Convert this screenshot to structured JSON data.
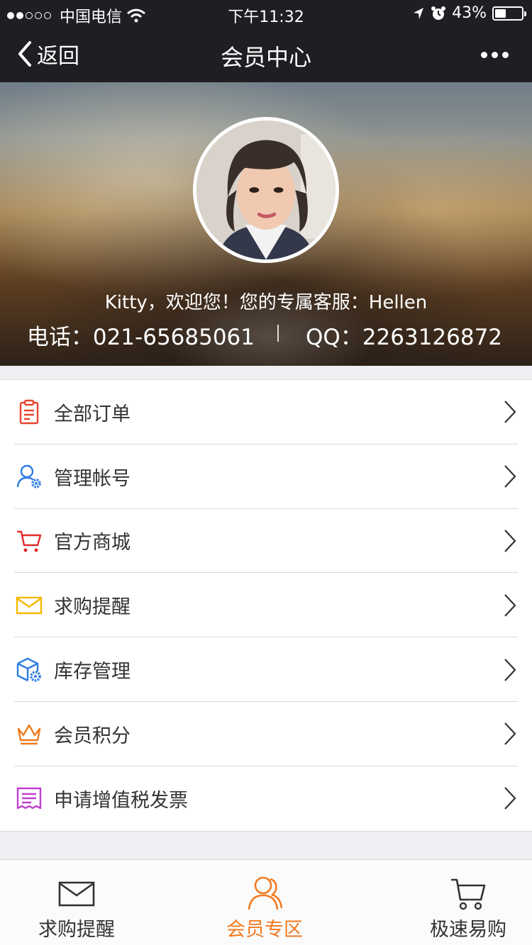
{
  "status_bar": {
    "carrier": "中国电信",
    "time": "下午11:32",
    "battery": "43%",
    "battery_level": 0.43,
    "signal_dots": [
      true,
      true,
      false,
      false,
      false
    ]
  },
  "nav": {
    "back_label": "返回",
    "title": "会员中心",
    "more_icon": "more-dots-icon"
  },
  "profile": {
    "welcome": "Kitty，欢迎您！您的专属客服：Hellen",
    "phone": "电话：021-65685061",
    "qq": "QQ：2263126872"
  },
  "menu": {
    "items": [
      {
        "label": "全部订单",
        "icon": "clipboard-icon",
        "color": "#e8452f"
      },
      {
        "label": "管理帐号",
        "icon": "user-gear-icon",
        "color": "#2f7de1"
      },
      {
        "label": "官方商城",
        "icon": "cart-icon",
        "color": "#e02b2b"
      },
      {
        "label": "求购提醒",
        "icon": "envelope-icon",
        "color": "#f5b800"
      },
      {
        "label": "库存管理",
        "icon": "box-gear-icon",
        "color": "#2f7de1"
      },
      {
        "label": "会员积分",
        "icon": "crown-icon",
        "color": "#f07a1a"
      },
      {
        "label": "申请增值税发票",
        "icon": "invoice-icon",
        "color": "#c03fd0"
      }
    ]
  },
  "tabbar": {
    "tabs": [
      {
        "label": "求购提醒",
        "icon": "envelope-icon",
        "active": false
      },
      {
        "label": "会员专区",
        "icon": "users-icon",
        "active": true
      },
      {
        "label": "极速易购",
        "icon": "cart-icon",
        "active": false
      }
    ],
    "active_color": "#f47a20"
  }
}
